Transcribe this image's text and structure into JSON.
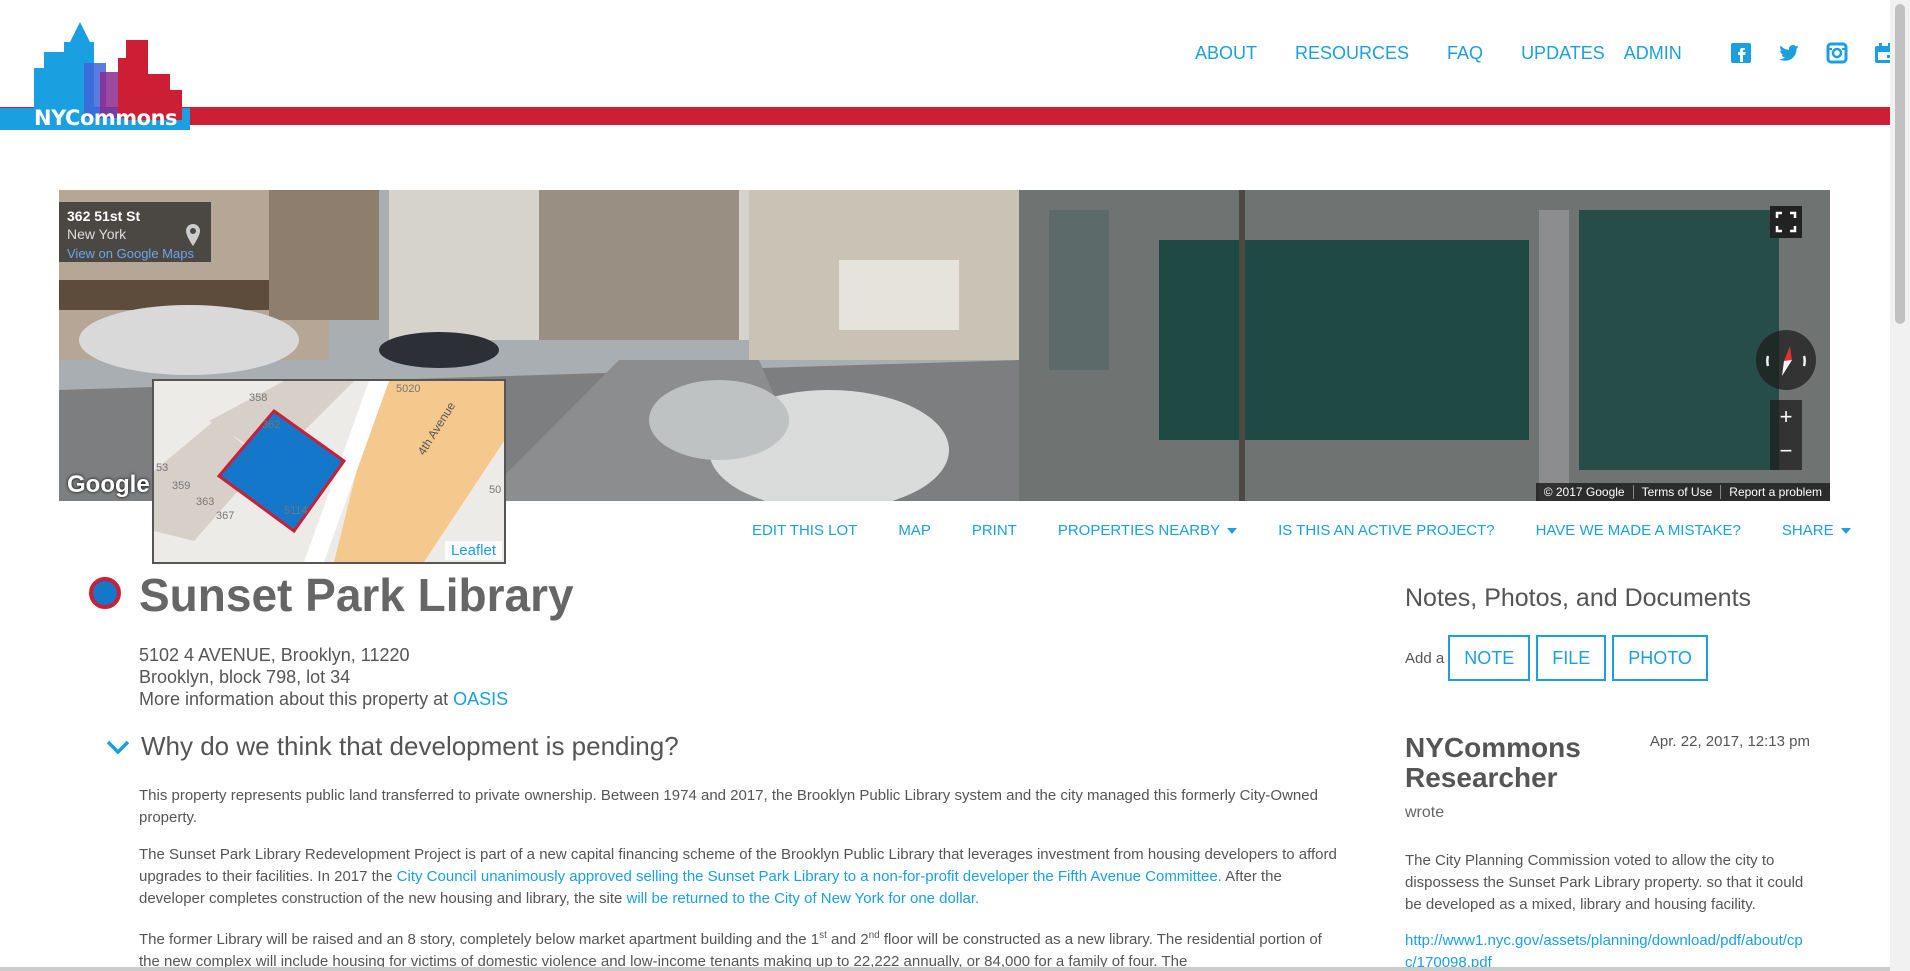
{
  "brand": {
    "name": "NYCommons",
    "red": "#cc1f36",
    "blue": "#1a9fe0"
  },
  "nav": {
    "items": [
      "ABOUT",
      "RESOURCES",
      "FAQ",
      "UPDATES",
      "ADMIN"
    ],
    "social": [
      "facebook-icon",
      "twitter-icon",
      "instagram-icon",
      "calendar-icon"
    ]
  },
  "streetview": {
    "address": "362 51st St",
    "city": "New York",
    "maps_link": "View on Google Maps",
    "google": "Google",
    "attribution": [
      "© 2017 Google",
      "Terms of Use",
      "Report a problem"
    ],
    "zoom_in": "+",
    "zoom_out": "−"
  },
  "minimap": {
    "labels": [
      "358",
      "362",
      "5020",
      "4th Avenue",
      "53",
      "359",
      "363",
      "367",
      "5114",
      "50"
    ],
    "attribution": "Leaflet"
  },
  "actions": [
    "EDIT THIS LOT",
    "MAP",
    "PRINT",
    "PROPERTIES NEARBY",
    "IS THIS AN ACTIVE PROJECT?",
    "HAVE WE MADE A MISTAKE?",
    "SHARE"
  ],
  "property": {
    "title": "Sunset Park Library",
    "address": "5102 4 AVENUE, Brooklyn, 11220",
    "block_lot": "Brooklyn, block 798, lot 34",
    "more_info": "More information about this property at",
    "oasis": "OASIS"
  },
  "why": {
    "heading": "Why do we think that development is pending?",
    "p1": " This property represents public land transferred to private ownership. Between 1974 and 2017, the Brooklyn Public Library system and the city managed this formerly City-Owned property.",
    "p2a": "The Sunset Park Library Redevelopment Project is part of a new capital financing scheme of the Brooklyn Public Library that leverages investment from housing developers to afford upgrades to their facilities. In 2017 the",
    "p2link1": "City Council unanimously approved selling the Sunset Park Library to a non-for-profit developer the Fifth Avenue Committee.",
    "p2b": "After the developer completes construction of the new housing and library, the site",
    "p2link2": "will be returned to the City of New York for one dollar.",
    "p3a": "The former Library will be raised and an 8 story, completely below market apartment building and the 1",
    "p3sup1": "st",
    "p3b": " and 2",
    "p3sup2": "nd",
    "p3c": " floor will be constructed as a new library. The residential portion of the new complex will include housing for victims of domestic violence and low-income tenants making up to 22,222 annually, or 84,000 for a family of four. The"
  },
  "sidebar": {
    "heading": "Notes, Photos, and Documents",
    "add_a": "Add a",
    "buttons": [
      "NOTE",
      "FILE",
      "PHOTO"
    ],
    "note": {
      "author": "NYCommons Researcher",
      "wrote": "wrote",
      "date": "Apr. 22, 2017, 12:13 pm",
      "body": "The City Planning Commission voted to allow the city to dispossess the Sunset Park Library property. so that it could be developed as a mixed, library and housing facility.",
      "link": "http://www1.nyc.gov/assets/planning/download/pdf/about/cpc/170098.pdf"
    }
  }
}
